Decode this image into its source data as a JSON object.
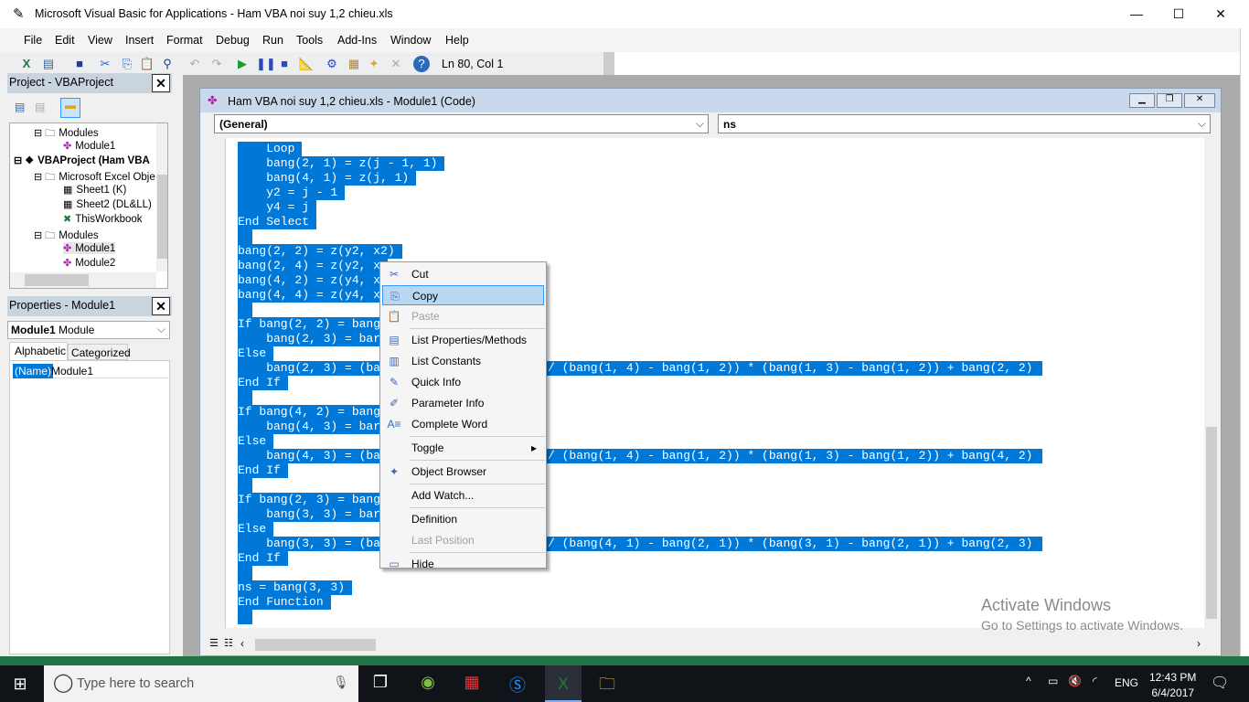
{
  "window": {
    "title": "Microsoft Visual Basic for Applications - Ham VBA noi suy 1,2 chieu.xls",
    "minimize": "—",
    "maximize": "☐",
    "close": "✕"
  },
  "menu": [
    "File",
    "Edit",
    "View",
    "Insert",
    "Format",
    "Debug",
    "Run",
    "Tools",
    "Add-Ins",
    "Window",
    "Help"
  ],
  "toolbar": {
    "position": "Ln 80, Col 1"
  },
  "project": {
    "title": "Project - VBAProject",
    "tree": [
      {
        "label": "Modules",
        "icon": "folder-icon"
      },
      {
        "label": "Module1",
        "icon": "module-icon"
      },
      {
        "label": "VBAProject (Ham VBA",
        "icon": "project-icon"
      },
      {
        "label": "Microsoft Excel Obje",
        "icon": "folder-icon"
      },
      {
        "label": "Sheet1 (K)",
        "icon": "sheet-icon"
      },
      {
        "label": "Sheet2 (DL&LL)",
        "icon": "sheet-icon"
      },
      {
        "label": "ThisWorkbook",
        "icon": "workbook-icon"
      },
      {
        "label": "Modules",
        "icon": "folder-icon"
      },
      {
        "label": "Module1",
        "icon": "module-icon"
      },
      {
        "label": "Module2",
        "icon": "module-icon"
      }
    ]
  },
  "properties": {
    "title": "Properties - Module1",
    "object_name": "Module1",
    "object_type": "Module",
    "tabs": [
      "Alphabetic",
      "Categorized"
    ],
    "rows": [
      {
        "name": "(Name)",
        "value": "Module1"
      }
    ]
  },
  "codewindow": {
    "title": "Ham VBA noi suy 1,2 chieu.xls - Module1 (Code)",
    "object_combo": "(General)",
    "proc_combo": "ns"
  },
  "code": [
    {
      "t": "    Loop"
    },
    {
      "t": "    bang(2, 1) = z(j - 1, 1)"
    },
    {
      "t": "    bang(4, 1) = z(j, 1)"
    },
    {
      "t": "    y2 = j - 1"
    },
    {
      "t": "    y4 = j"
    },
    {
      "t": "End Select"
    },
    {
      "t": ""
    },
    {
      "t": "bang(2, 2) = z(y2, x2)"
    },
    {
      "t": "bang(2, 4) = z(y2, x"
    },
    {
      "t": "bang(4, 2) = z(y4, x"
    },
    {
      "t": "bang(4, 4) = z(y4, x"
    },
    {
      "t": ""
    },
    {
      "t": "If bang(2, 2) = bang"
    },
    {
      "t": "    bang(2, 3) = bar"
    },
    {
      "t": "Else"
    },
    {
      "t": "    bang(2, 3) = (ba",
      "r": "/ (bang(1, 4) - bang(1, 2)) * (bang(1, 3) - bang(1, 2)) + bang(2, 2)"
    },
    {
      "t": "End If"
    },
    {
      "t": ""
    },
    {
      "t": "If bang(4, 2) = bang"
    },
    {
      "t": "    bang(4, 3) = bar"
    },
    {
      "t": "Else"
    },
    {
      "t": "    bang(4, 3) = (ba",
      "r": "/ (bang(1, 4) - bang(1, 2)) * (bang(1, 3) - bang(1, 2)) + bang(4, 2)"
    },
    {
      "t": "End If"
    },
    {
      "t": ""
    },
    {
      "t": "If bang(2, 3) = bang"
    },
    {
      "t": "    bang(3, 3) = bar"
    },
    {
      "t": "Else"
    },
    {
      "t": "    bang(3, 3) = (ba",
      "r": "/ (bang(4, 1) - bang(2, 1)) * (bang(3, 1) - bang(2, 1)) + bang(2, 3)"
    },
    {
      "t": "End If"
    },
    {
      "t": ""
    },
    {
      "t": "ns = bang(3, 3)"
    },
    {
      "t": "End Function"
    },
    {
      "t": ""
    }
  ],
  "context_menu": [
    {
      "label": "Cut",
      "icon": "cut-icon"
    },
    {
      "label": "Copy",
      "icon": "copy-icon",
      "selected": true
    },
    {
      "label": "Paste",
      "icon": "paste-icon",
      "disabled": true
    },
    {
      "label": "List Properties/Methods",
      "icon": "list-properties-icon"
    },
    {
      "label": "List Constants",
      "icon": "list-constants-icon"
    },
    {
      "label": "Quick Info",
      "icon": "quick-info-icon"
    },
    {
      "label": "Parameter Info",
      "icon": "parameter-info-icon"
    },
    {
      "label": "Complete Word",
      "icon": "complete-word-icon"
    },
    {
      "label": "Toggle",
      "submenu": true
    },
    {
      "label": "Object Browser",
      "icon": "object-browser-icon"
    },
    {
      "label": "Add Watch..."
    },
    {
      "label": "Definition"
    },
    {
      "label": "Last Position",
      "disabled": true
    },
    {
      "label": "Hide",
      "icon": "hide-icon"
    }
  ],
  "watermark": {
    "title": "Activate Windows",
    "subtitle": "Go to Settings to activate Windows."
  },
  "taskbar": {
    "search_placeholder": "Type here to search",
    "language": "ENG",
    "time": "12:43 PM",
    "date": "6/4/2017"
  },
  "colors": {
    "selection": "#0078d7",
    "taskbar": "#101318",
    "excel_green": "#217346"
  }
}
